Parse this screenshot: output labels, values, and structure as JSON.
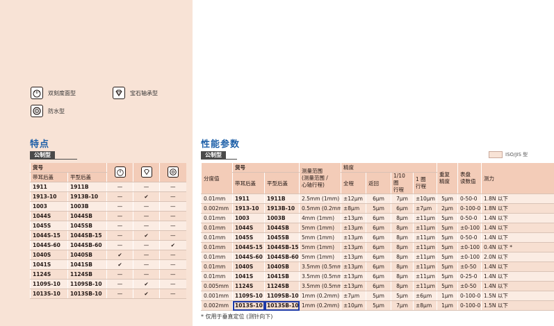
{
  "legend": {
    "dial_type": {
      "icon": "dual-scale-dial-icon",
      "label": "双刻度面型"
    },
    "jewel_type": {
      "icon": "jewel-bearing-icon",
      "label": "宝石轴承型"
    },
    "waterproof_type": {
      "icon": "waterproof-icon",
      "label": "防水型"
    }
  },
  "features": {
    "title": "特点",
    "tag": "公制型",
    "headers": {
      "part_no": "货号",
      "lug_back": "带耳后盖",
      "flat_back": "平型后盖"
    },
    "check_mark": "✔",
    "dash": "—",
    "rows": [
      {
        "lug": "1911",
        "flat": "1911B",
        "dial": "—",
        "jewel": "—",
        "water": "—"
      },
      {
        "lug": "1913-10",
        "flat": "1913B-10",
        "dial": "—",
        "jewel": "✔",
        "water": "—"
      },
      {
        "lug": "1003",
        "flat": "1003B",
        "dial": "—",
        "jewel": "—",
        "water": "—"
      },
      {
        "lug": "1044S",
        "flat": "1044SB",
        "dial": "—",
        "jewel": "—",
        "water": "—"
      },
      {
        "lug": "1045S",
        "flat": "1045SB",
        "dial": "—",
        "jewel": "—",
        "water": "—"
      },
      {
        "lug": "1044S-15",
        "flat": "1044SB-15",
        "dial": "—",
        "jewel": "✔",
        "water": "—"
      },
      {
        "lug": "1044S-60",
        "flat": "1044SB-60",
        "dial": "—",
        "jewel": "—",
        "water": "✔"
      },
      {
        "lug": "1040S",
        "flat": "1040SB",
        "dial": "✔",
        "jewel": "—",
        "water": "—"
      },
      {
        "lug": "1041S",
        "flat": "1041SB",
        "dial": "✔",
        "jewel": "—",
        "water": "—"
      },
      {
        "lug": "1124S",
        "flat": "1124SB",
        "dial": "—",
        "jewel": "—",
        "water": "—"
      },
      {
        "lug": "1109S-10",
        "flat": "1109SB-10",
        "dial": "—",
        "jewel": "✔",
        "water": "—"
      },
      {
        "lug": "1013S-10",
        "flat": "1013SB-10",
        "dial": "—",
        "jewel": "✔",
        "water": "—"
      }
    ]
  },
  "specs": {
    "title": "性能参数",
    "tag": "公制型",
    "iso_label": "ISO/JIS 型",
    "headers": {
      "graduation": "分度值",
      "part_no": "货号",
      "lug_back": "带耳后盖",
      "flat_back": "平型后盖",
      "range": "测量范围\n(测量范围 /\n心轴行程)",
      "accuracy": "精度",
      "full": "全程",
      "retrace": "返回",
      "tenth_rev": "1/10 圈\n行程",
      "one_rev": "1 圈\n行程",
      "repeat": "重复\n精度",
      "dial_reading": "表盘\n读数值",
      "force": "测力"
    },
    "rows": [
      {
        "grad": "0.01mm",
        "lug": "1911",
        "flat": "1911B",
        "range": "2.5mm (1mm)",
        "full": "±12μm",
        "ret": "6μm",
        "tenth": "7μm",
        "one": "±10μm",
        "rep": "5μm",
        "dial": "0-50-0",
        "force": "1.8N 以下"
      },
      {
        "grad": "0.002mm",
        "lug": "1913-10",
        "flat": "1913B-10",
        "range": "0.5mm (0.2mm)",
        "full": "±8μm",
        "ret": "5μm",
        "tenth": "6μm",
        "one": "±7μm",
        "rep": "2μm",
        "dial": "0-100-0",
        "force": "1.8N 以下"
      },
      {
        "grad": "0.01mm",
        "lug": "1003",
        "flat": "1003B",
        "range": "4mm (1mm)",
        "full": "±13μm",
        "ret": "6μm",
        "tenth": "8μm",
        "one": "±11μm",
        "rep": "5μm",
        "dial": "0-50-0",
        "force": "1.4N 以下"
      },
      {
        "grad": "0.01mm",
        "lug": "1044S",
        "flat": "1044SB",
        "range": "5mm (1mm)",
        "full": "±13μm",
        "ret": "6μm",
        "tenth": "8μm",
        "one": "±11μm",
        "rep": "5μm",
        "dial": "±0-100",
        "force": "1.4N 以下"
      },
      {
        "grad": "0.01mm",
        "lug": "1045S",
        "flat": "1045SB",
        "range": "5mm (1mm)",
        "full": "±13μm",
        "ret": "6μm",
        "tenth": "8μm",
        "one": "±11μm",
        "rep": "5μm",
        "dial": "0-50-0",
        "force": "1.4N 以下"
      },
      {
        "grad": "0.01mm",
        "lug": "1044S-15",
        "flat": "1044SB-15",
        "range": "5mm (1mm)",
        "full": "±13μm",
        "ret": "6μm",
        "tenth": "8μm",
        "one": "±11μm",
        "rep": "5μm",
        "dial": "±0-100",
        "force": "0.4N 以下 *"
      },
      {
        "grad": "0.01mm",
        "lug": "1044S-60",
        "flat": "1044SB-60",
        "range": "5mm (1mm)",
        "full": "±13μm",
        "ret": "6μm",
        "tenth": "8μm",
        "one": "±11μm",
        "rep": "5μm",
        "dial": "±0-100",
        "force": "2.0N 以下"
      },
      {
        "grad": "0.01mm",
        "lug": "1040S",
        "flat": "1040SB",
        "range": "3.5mm (0.5mm)",
        "full": "±13μm",
        "ret": "6μm",
        "tenth": "8μm",
        "one": "±11μm",
        "rep": "5μm",
        "dial": "±0-50",
        "force": "1.4N 以下"
      },
      {
        "grad": "0.01mm",
        "lug": "1041S",
        "flat": "1041SB",
        "range": "3.5mm (0.5mm)",
        "full": "±13μm",
        "ret": "6μm",
        "tenth": "8μm",
        "one": "±11μm",
        "rep": "5μm",
        "dial": "0-25-0",
        "force": "1.4N 以下"
      },
      {
        "grad": "0.005mm",
        "lug": "1124S",
        "flat": "1124SB",
        "range": "3.5mm (0.5mm)",
        "full": "±13μm",
        "ret": "6μm",
        "tenth": "8μm",
        "one": "±11μm",
        "rep": "5μm",
        "dial": "±0-50",
        "force": "1.4N 以下"
      },
      {
        "grad": "0.001mm",
        "lug": "1109S-10",
        "flat": "1109SB-10",
        "range": "1mm (0.2mm)",
        "full": "±7μm",
        "ret": "5μm",
        "tenth": "5μm",
        "one": "±6μm",
        "rep": "1μm",
        "dial": "0-100-0",
        "force": "1.5N 以下"
      },
      {
        "grad": "0.002mm",
        "lug": "1013S-10",
        "flat": "1013SB-10",
        "range": "1mm (0.2mm)",
        "full": "±10μm",
        "ret": "5μm",
        "tenth": "7μm",
        "one": "±8μm",
        "rep": "1μm",
        "dial": "0-100-0",
        "force": "1.5N 以下"
      }
    ]
  },
  "footnote": "* 仅用于垂直定位 (测针向下)"
}
